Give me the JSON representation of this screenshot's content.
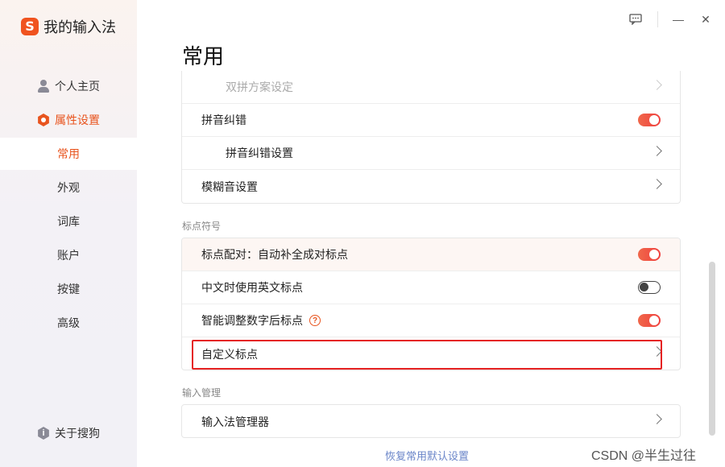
{
  "app": {
    "title": "我的输入法",
    "logo_letter": "S",
    "accent": "#e8541e"
  },
  "sidebar": {
    "items": [
      {
        "label": "个人主页",
        "icon": "person-icon"
      },
      {
        "label": "属性设置",
        "icon": "hexagon-settings-icon"
      }
    ],
    "subitems": [
      {
        "label": "常用",
        "active": true
      },
      {
        "label": "外观"
      },
      {
        "label": "词库"
      },
      {
        "label": "账户"
      },
      {
        "label": "按键"
      },
      {
        "label": "高级"
      }
    ],
    "about": {
      "label": "关于搜狗",
      "icon": "info-icon",
      "glyph": "i"
    }
  },
  "window": {
    "feedback_glyph": "⋯",
    "minimize_glyph": "—",
    "close_glyph": "✕"
  },
  "main": {
    "title": "常用",
    "card1": [
      {
        "label": "双拼方案设定",
        "control": "chevron",
        "disabled": true
      },
      {
        "label": "拼音纠错",
        "control": "toggle",
        "on": true
      },
      {
        "label": "拼音纠错设置",
        "control": "chevron"
      },
      {
        "label": "模糊音设置",
        "control": "chevron"
      }
    ],
    "section2": "标点符号",
    "card2": [
      {
        "label": "标点配对：自动补全成对标点",
        "control": "toggle",
        "on": true
      },
      {
        "label": "中文时使用英文标点",
        "control": "toggle",
        "on": false
      },
      {
        "label": "智能调整数字后标点",
        "control": "toggle",
        "on": true,
        "help": "?"
      },
      {
        "label": "自定义标点",
        "control": "chevron"
      }
    ],
    "section3": "输入管理",
    "card3": [
      {
        "label": "输入法管理器",
        "control": "chevron"
      }
    ],
    "reset_link": "恢复常用默认设置"
  },
  "watermark": "CSDN @半生过往"
}
